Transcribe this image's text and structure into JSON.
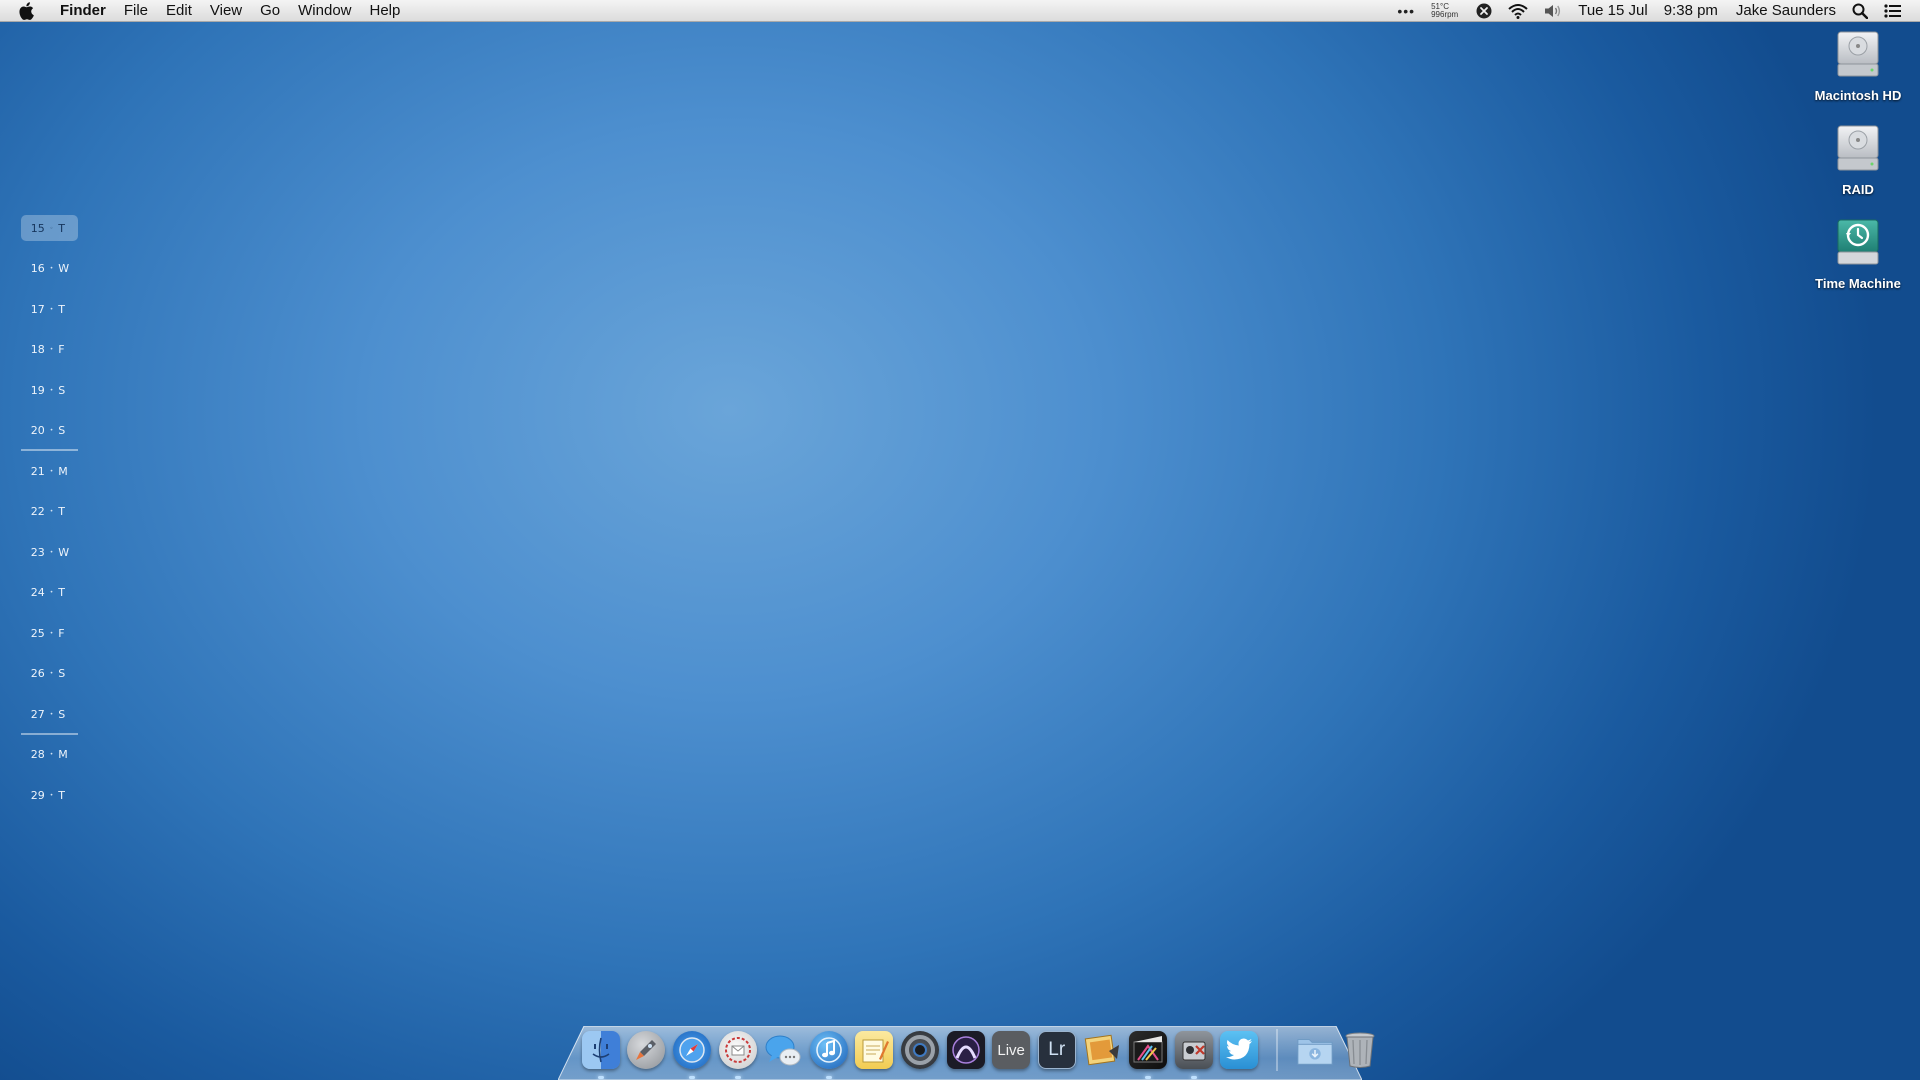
{
  "menubar": {
    "app_name": "Finder",
    "menus": [
      "File",
      "Edit",
      "View",
      "Go",
      "Window",
      "Help"
    ],
    "sensor_temp": "51°C",
    "sensor_fan": "996rpm",
    "date": "Tue 15 Jul",
    "time": "9:38 pm",
    "user": "Jake Saunders",
    "status_icons": [
      "more-dots-icon",
      "bluetooth-off-icon",
      "wifi-icon",
      "volume-icon",
      "spotlight-icon",
      "notification-center-icon"
    ]
  },
  "calendar": {
    "today_index": 0,
    "days": [
      {
        "day": "15",
        "weekday": "T"
      },
      {
        "day": "16",
        "weekday": "W"
      },
      {
        "day": "17",
        "weekday": "T"
      },
      {
        "day": "18",
        "weekday": "F"
      },
      {
        "day": "19",
        "weekday": "S"
      },
      {
        "day": "20",
        "weekday": "S"
      },
      {
        "day": "21",
        "weekday": "M"
      },
      {
        "day": "22",
        "weekday": "T"
      },
      {
        "day": "23",
        "weekday": "W"
      },
      {
        "day": "24",
        "weekday": "T"
      },
      {
        "day": "25",
        "weekday": "F"
      },
      {
        "day": "26",
        "weekday": "S"
      },
      {
        "day": "27",
        "weekday": "S"
      },
      {
        "day": "28",
        "weekday": "M"
      },
      {
        "day": "29",
        "weekday": "T"
      }
    ]
  },
  "desktop_icons": [
    {
      "label": "Macintosh HD",
      "icon": "hard-drive-icon"
    },
    {
      "label": "RAID",
      "icon": "hard-drive-icon"
    },
    {
      "label": "Time Machine",
      "icon": "time-machine-drive-icon"
    }
  ],
  "dock": {
    "apps": [
      {
        "name": "Finder",
        "icon": "finder-icon",
        "running": true
      },
      {
        "name": "Launchpad",
        "icon": "launchpad-icon",
        "running": false
      },
      {
        "name": "Safari",
        "icon": "safari-icon",
        "running": true
      },
      {
        "name": "Mail",
        "icon": "mail-icon",
        "running": true
      },
      {
        "name": "Messages",
        "icon": "messages-icon",
        "running": false
      },
      {
        "name": "iTunes",
        "icon": "itunes-icon",
        "running": true
      },
      {
        "name": "Notes",
        "icon": "notes-icon",
        "running": false
      },
      {
        "name": "Logic",
        "icon": "logic-icon",
        "running": false
      },
      {
        "name": "Pro Tools",
        "icon": "pro-tools-icon",
        "running": false
      },
      {
        "name": "Live",
        "icon": "ableton-live-icon",
        "text": "Live",
        "running": false
      },
      {
        "name": "Lightroom",
        "icon": "lightroom-icon",
        "text": "Lr",
        "running": false
      },
      {
        "name": "iPhoto",
        "icon": "iphoto-icon",
        "running": false
      },
      {
        "name": "Final Cut Pro",
        "icon": "final-cut-pro-icon",
        "running": true
      },
      {
        "name": "Utility",
        "icon": "utility-app-icon",
        "running": true
      },
      {
        "name": "Twitter",
        "icon": "twitter-icon",
        "running": false
      }
    ],
    "stacks": [
      {
        "name": "Downloads",
        "icon": "downloads-folder-icon"
      },
      {
        "name": "Trash",
        "icon": "trash-icon"
      }
    ]
  },
  "colors": {
    "menubar": "#e6e6e6",
    "desktop_light": "#6aa5d9",
    "desktop_dark": "#124c8e",
    "label_text": "#ffffff"
  }
}
